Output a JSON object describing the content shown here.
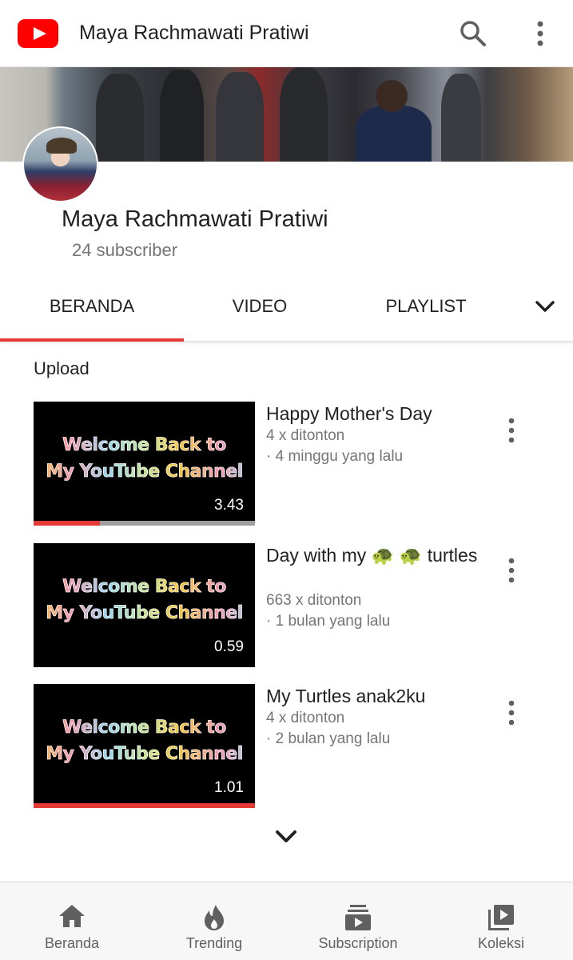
{
  "appbar": {
    "title": "Maya Rachmawati Pratiwi",
    "icons": [
      "youtube-logo",
      "search-icon",
      "more-vert-icon"
    ]
  },
  "channel": {
    "name": "Maya Rachmawati Pratiwi",
    "subscribers": "24 subscriber"
  },
  "tabs": [
    {
      "label": "BERANDA",
      "selected": true
    },
    {
      "label": "VIDEO",
      "selected": false
    },
    {
      "label": "PLAYLIST",
      "selected": false
    }
  ],
  "section": {
    "title": "Upload"
  },
  "thumbnail_text": {
    "line1": "Welcome Back to",
    "line2": "My YouTube Channel"
  },
  "videos": [
    {
      "title": "Happy Mother's Day",
      "views": "4 x ditonton",
      "age": "· 4 minggu yang lalu",
      "duration": "3.43",
      "watched_fraction": 0.3
    },
    {
      "title": "Day with my 🐢 🐢 turtles",
      "views": "663 x ditonton",
      "age": "· 1 bulan yang lalu",
      "duration": "0.59",
      "watched_fraction": 0
    },
    {
      "title": "My Turtles anak2ku",
      "views": "4 x ditonton",
      "age": "· 2 bulan yang lalu",
      "duration": "1.01",
      "watched_fraction": 1.0
    }
  ],
  "bottom_nav": [
    {
      "label": "Beranda",
      "icon": "home-icon"
    },
    {
      "label": "Trending",
      "icon": "trending-flame-icon"
    },
    {
      "label": "Subscription",
      "icon": "subscriptions-icon"
    },
    {
      "label": "Koleksi",
      "icon": "library-icon"
    }
  ],
  "colors": {
    "accent": "#e53935",
    "youtube_red": "#ff0000",
    "text": "#212121",
    "secondary_text": "#757575"
  }
}
